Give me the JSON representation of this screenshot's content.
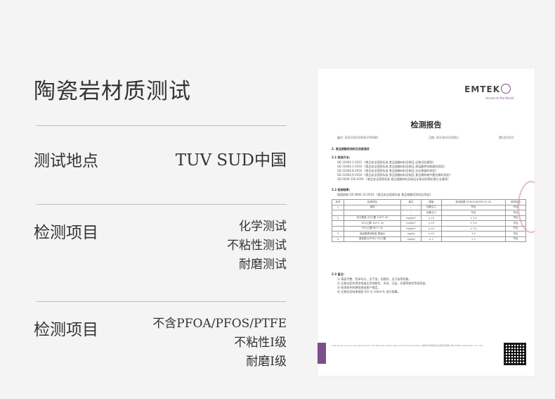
{
  "heading": "陶瓷岩材质测试",
  "rows": [
    {
      "label": "测试地点",
      "values": [
        "TUV SUD中国"
      ]
    },
    {
      "label": "检测项目",
      "values": [
        "化学测试",
        "不粘性测试",
        "耐磨测试"
      ]
    },
    {
      "label": "检测项目",
      "values": [
        "不含PFOA/PFOS/PTFE",
        "不粘性I级",
        "耐磨I级"
      ]
    }
  ],
  "report": {
    "logo": "EMTEK",
    "tagline": "Access to the World",
    "title": "检测报告",
    "report_no": "编号: ESZ23021800037000IR",
    "date": "日期: 2023年03月08日",
    "page": "第5页共5页",
    "section2": "2. 食品接触用涂料及涂层测试",
    "s21": "2.1 检测方法:",
    "methods": [
      "GB 31604.1-2015 《食品安全国家标准 食品接触材料及制品 迁移试验通则》",
      "GB 31604.1-2016 《食品安全国家标准 食品接触材料及制品 高锰酸钾消耗量的测定》",
      "GB 31604.8-2016 《食品安全国家标准 食品接触材料及制品 总迁移量的测定》",
      "GB 31604.9-2016 《食品安全国家标准 食品接触材料及制品 食品模拟物中重金属的测定》",
      "GB 5009.156-2016 《食品安全国家标准 食品接触材料及制品迁移试验预处理方法通则》"
    ],
    "s22": "2.2 检测结果:",
    "standard": "限值依据 GB 4806.10-2016 《食品安全国家标准 食品接触用涂料及涂层》",
    "table_headers": [
      "序号",
      "检测项目",
      "单位",
      "限值",
      "检测结果 E2302180003-01.02",
      "单项结论"
    ],
    "table_rows": [
      [
        "1",
        "感官",
        "--",
        "见备注1)",
        "符合",
        "符合"
      ],
      [
        "",
        "",
        "--",
        "见备注2)",
        "符合",
        "符合"
      ],
      [
        "2",
        "总迁移量 4%乙酸 100℃ 4h",
        "mg/dm²",
        "≤ 10",
        "< 3.0",
        "符合"
      ],
      [
        "",
        "10%乙醇 100℃ 4h",
        "mg/dm²",
        "≤ 10",
        "< 3.0",
        "符合"
      ],
      [
        "",
        "95%乙醇 60℃ 4h",
        "mg/dm²",
        "≤ 10",
        "< 3.0",
        "符合"
      ],
      [
        "3",
        "高锰酸钾消耗量 蒸馏水",
        "mg/kg",
        "≤ 10",
        "1.4",
        "符合"
      ],
      [
        "4",
        "重金属(以Pb计) 4%乙酸",
        "mg/kg",
        "≤ 1",
        "< 1",
        "符合"
      ]
    ],
    "s23": "2.3 备注:",
    "notes": [
      "1) 表面平整、色泽均匀、无气泡、无裂纹、无污染等现象。",
      "2) 迁移试验所得浸泡液无异常着色、浑浊、沉淀、异臭等感官性质改变。",
      "3) 检测条件和模拟液由客户指定。",
      "4) 迁移实验结果按照 S/V 为 10dm²/L 进行换算。"
    ],
    "footer": "This report can only be reproduced in full with the written approval of the laboratory. 深圳市华测检测认证股份有限公司 EMTEK (Shenzhen) Co., Ltd."
  }
}
